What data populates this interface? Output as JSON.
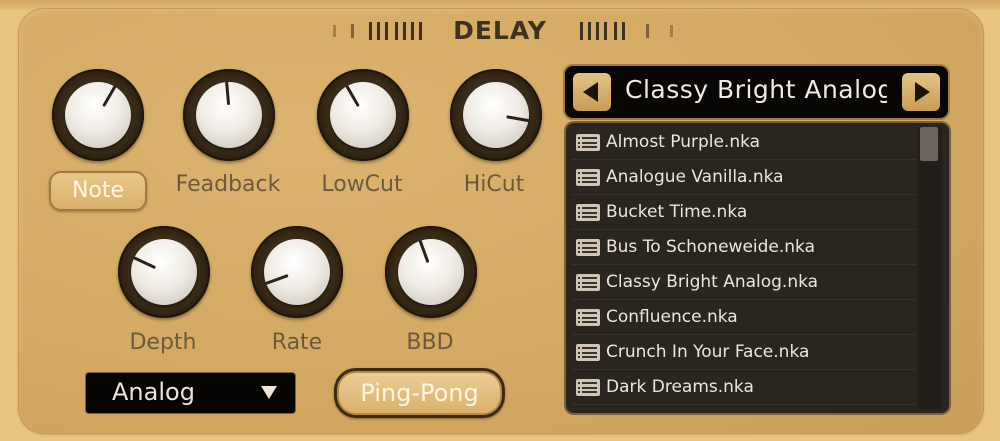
{
  "panel": {
    "title": "DELAY"
  },
  "knobs": [
    {
      "label": "Note",
      "angle_deg": 30
    },
    {
      "label": "Feadback",
      "angle_deg": -5
    },
    {
      "label": "LowCut",
      "angle_deg": -30
    },
    {
      "label": "HiCut",
      "angle_deg": 100
    },
    {
      "label": "Depth",
      "angle_deg": -65
    },
    {
      "label": "Rate",
      "angle_deg": -110
    },
    {
      "label": "BBD",
      "angle_deg": -20
    }
  ],
  "buttons": {
    "note": "Note",
    "ping_pong": "Ping-Pong"
  },
  "mode_select": {
    "value": "Analog",
    "icon": "triangle-down-icon"
  },
  "preset": {
    "name": "Classy Bright Analog",
    "prev_icon": "triangle-left-icon",
    "next_icon": "triangle-right-icon"
  },
  "preset_list": [
    "Almost Purple.nka",
    "Analogue Vanilla.nka",
    "Bucket Time.nka",
    "Bus To Schoneweide.nka",
    "Classy Bright Analog.nka",
    "Confluence.nka",
    "Crunch In Your Face.nka",
    "Dark Dreams.nka"
  ],
  "colors": {
    "panel": "#d2a862",
    "label": "#6b5a3e",
    "list_bg": "#2b2520",
    "button_text": "#fff6e0"
  }
}
